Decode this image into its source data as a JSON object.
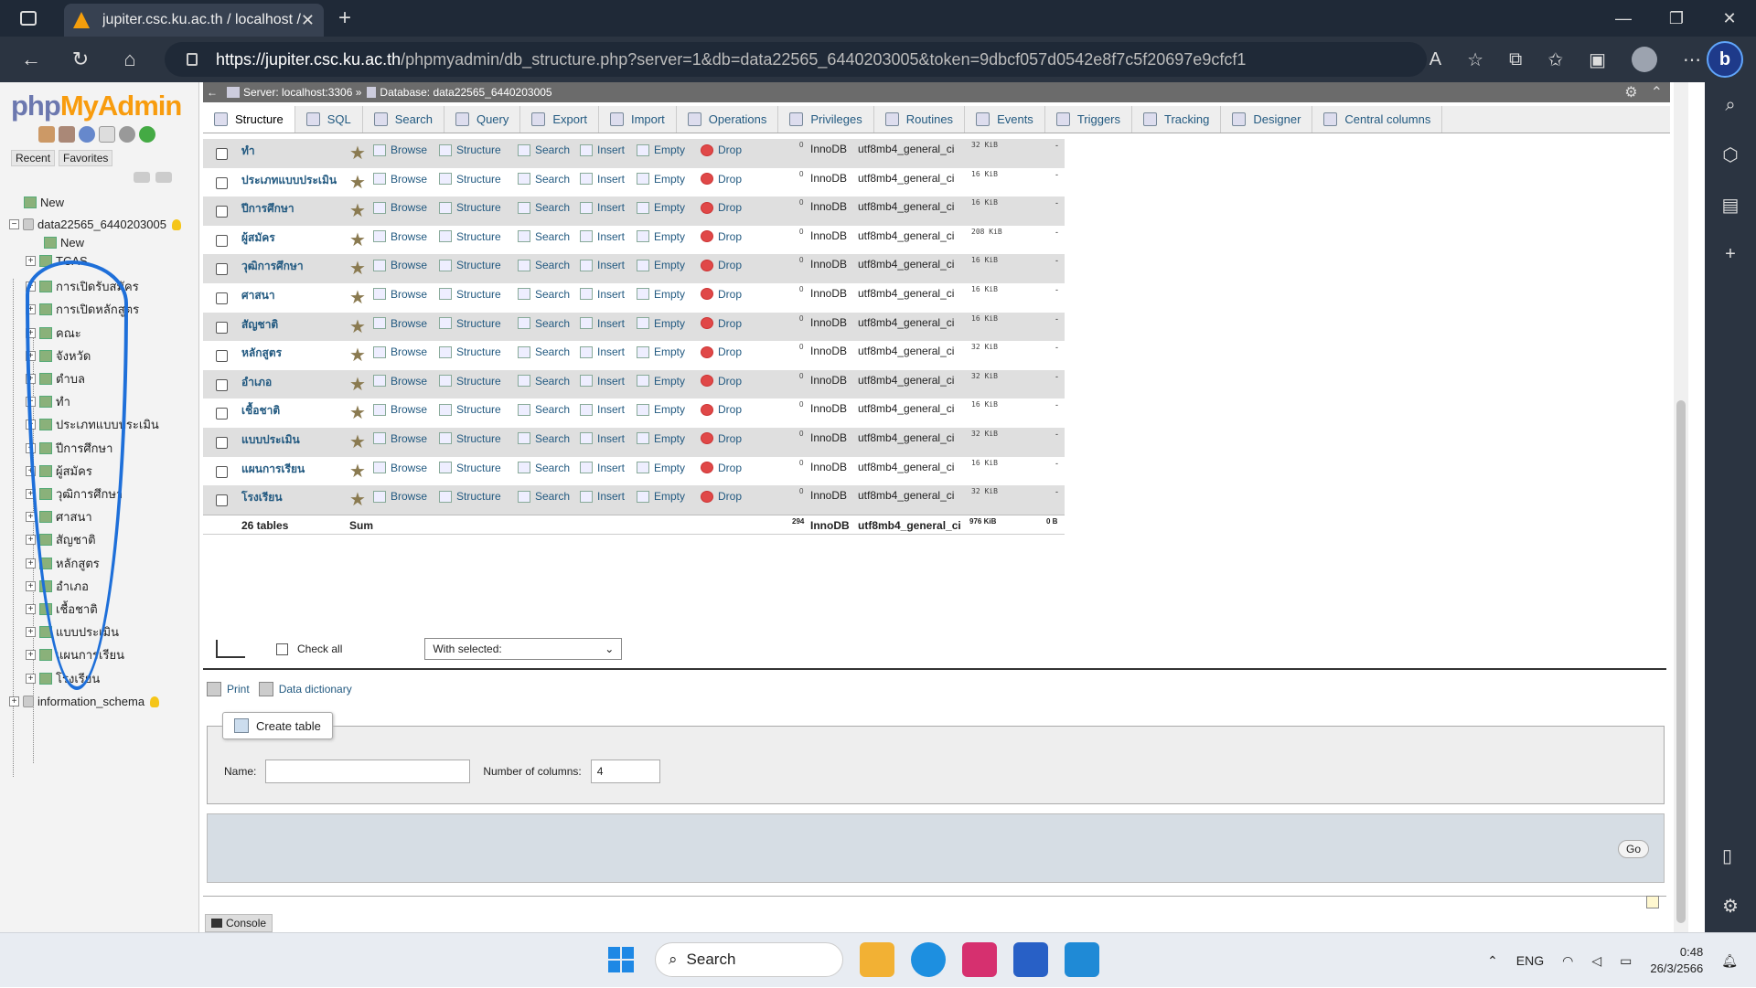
{
  "browser": {
    "tab_title": "jupiter.csc.ku.ac.th / localhost / d",
    "url_host": "https://jupiter.csc.ku.ac.th",
    "url_path": "/phpmyadmin/db_structure.php?server=1&db=data22565_6440203005&token=9dbcf057d0542e8f7c5f20697e9cfcf1"
  },
  "sidebar": {
    "logo_php": "php",
    "logo_my": "MyAdmin",
    "recent": "Recent",
    "favorites": "Favorites",
    "new_top": "New",
    "db_name": "data22565_6440203005",
    "new_table": "New",
    "tables": [
      "TCAS",
      "การเปิดรับสมัคร",
      "การเปิดหลักสูตร",
      "คณะ",
      "จังหวัด",
      "ตำบล",
      "ทำ",
      "ประเภทแบบประเมิน",
      "ปีการศึกษา",
      "ผู้สมัคร",
      "วุฒิการศึกษา",
      "ศาสนา",
      "สัญชาติ",
      "หลักสูตร",
      "อำเภอ",
      "เชื้อชาติ",
      "แบบประเมิน",
      "แผนการเรียน",
      "โรงเรียน"
    ],
    "other_db": "information_schema"
  },
  "breadcrumb": {
    "server": "Server: localhost:3306 »",
    "database": "Database: data22565_6440203005"
  },
  "tabs": [
    "Structure",
    "SQL",
    "Search",
    "Query",
    "Export",
    "Import",
    "Operations",
    "Privileges",
    "Routines",
    "Events",
    "Triggers",
    "Tracking",
    "Designer",
    "Central columns"
  ],
  "actions": {
    "browse": "Browse",
    "structure": "Structure",
    "search": "Search",
    "insert": "Insert",
    "empty": "Empty",
    "drop": "Drop"
  },
  "rows": [
    {
      "name": "ทำ",
      "rows": "0",
      "engine": "InnoDB",
      "collation": "utf8mb4_general_ci",
      "size": "32 KiB",
      "overhead": "-"
    },
    {
      "name": "ประเภทแบบประเมิน",
      "rows": "0",
      "engine": "InnoDB",
      "collation": "utf8mb4_general_ci",
      "size": "16 KiB",
      "overhead": "-"
    },
    {
      "name": "ปีการศึกษา",
      "rows": "0",
      "engine": "InnoDB",
      "collation": "utf8mb4_general_ci",
      "size": "16 KiB",
      "overhead": "-"
    },
    {
      "name": "ผู้สมัคร",
      "rows": "0",
      "engine": "InnoDB",
      "collation": "utf8mb4_general_ci",
      "size": "208 KiB",
      "overhead": "-"
    },
    {
      "name": "วุฒิการศึกษา",
      "rows": "0",
      "engine": "InnoDB",
      "collation": "utf8mb4_general_ci",
      "size": "16 KiB",
      "overhead": "-"
    },
    {
      "name": "ศาสนา",
      "rows": "0",
      "engine": "InnoDB",
      "collation": "utf8mb4_general_ci",
      "size": "16 KiB",
      "overhead": "-"
    },
    {
      "name": "สัญชาติ",
      "rows": "0",
      "engine": "InnoDB",
      "collation": "utf8mb4_general_ci",
      "size": "16 KiB",
      "overhead": "-"
    },
    {
      "name": "หลักสูตร",
      "rows": "0",
      "engine": "InnoDB",
      "collation": "utf8mb4_general_ci",
      "size": "32 KiB",
      "overhead": "-"
    },
    {
      "name": "อำเภอ",
      "rows": "0",
      "engine": "InnoDB",
      "collation": "utf8mb4_general_ci",
      "size": "32 KiB",
      "overhead": "-"
    },
    {
      "name": "เชื้อชาติ",
      "rows": "0",
      "engine": "InnoDB",
      "collation": "utf8mb4_general_ci",
      "size": "16 KiB",
      "overhead": "-"
    },
    {
      "name": "แบบประเมิน",
      "rows": "0",
      "engine": "InnoDB",
      "collation": "utf8mb4_general_ci",
      "size": "32 KiB",
      "overhead": "-"
    },
    {
      "name": "แผนการเรียน",
      "rows": "0",
      "engine": "InnoDB",
      "collation": "utf8mb4_general_ci",
      "size": "16 KiB",
      "overhead": "-"
    },
    {
      "name": "โรงเรียน",
      "rows": "0",
      "engine": "InnoDB",
      "collation": "utf8mb4_general_ci",
      "size": "32 KiB",
      "overhead": "-"
    }
  ],
  "summary": {
    "tables": "26 tables",
    "sum": "Sum",
    "rows": "294",
    "engine": "InnoDB",
    "collation": "utf8mb4_general_ci",
    "size": "976 KiB",
    "overhead": "0 B"
  },
  "footer": {
    "check_all": "Check all",
    "with_selected": "With selected:",
    "print": "Print",
    "data_dictionary": "Data dictionary",
    "create_table": "Create table",
    "name_label": "Name:",
    "name_value": "",
    "columns_label": "Number of columns:",
    "columns_value": "4",
    "go": "Go",
    "console": "Console"
  },
  "taskbar": {
    "search": "Search",
    "lang": "ENG",
    "time": "0:48",
    "date": "26/3/2566"
  }
}
